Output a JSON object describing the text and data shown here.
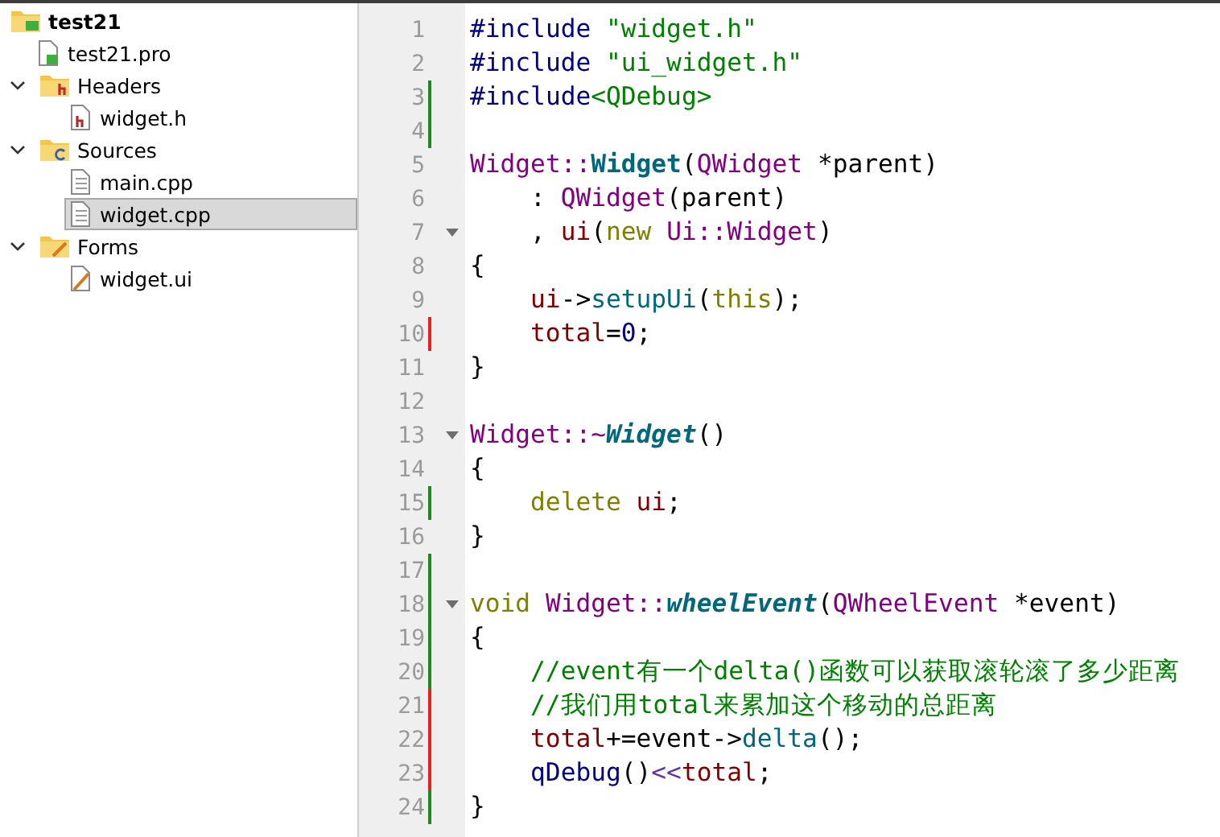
{
  "project_tree": {
    "label": "test21",
    "kind": "project",
    "selected": false,
    "children": [
      {
        "label": "test21.pro",
        "kind": "pro-file",
        "selected": false
      },
      {
        "label": "Headers",
        "kind": "header-folder",
        "selected": false,
        "expanded": true,
        "children": [
          {
            "label": "widget.h",
            "kind": "header-file",
            "selected": false
          }
        ]
      },
      {
        "label": "Sources",
        "kind": "source-folder",
        "selected": false,
        "expanded": true,
        "children": [
          {
            "label": "main.cpp",
            "kind": "source-file",
            "selected": false
          },
          {
            "label": "widget.cpp",
            "kind": "source-file",
            "selected": true
          }
        ]
      },
      {
        "label": "Forms",
        "kind": "form-folder",
        "selected": false,
        "expanded": true,
        "children": [
          {
            "label": "widget.ui",
            "kind": "form-file",
            "selected": false
          }
        ]
      }
    ]
  },
  "editor": {
    "lines": [
      {
        "number": "1",
        "added": false,
        "modified": false,
        "foldable": false,
        "indented": false,
        "tokens": [
          {
            "text": "#include ",
            "kind": "preprocessor"
          },
          {
            "text": "\"widget.h\"",
            "kind": "string"
          }
        ]
      },
      {
        "number": "2",
        "added": false,
        "modified": false,
        "foldable": false,
        "indented": false,
        "tokens": [
          {
            "text": "#include ",
            "kind": "preprocessor"
          },
          {
            "text": "\"ui_widget.h\"",
            "kind": "string"
          }
        ]
      },
      {
        "number": "3",
        "added": true,
        "modified": false,
        "foldable": false,
        "indented": false,
        "tokens": [
          {
            "text": "#include",
            "kind": "preprocessor"
          },
          {
            "text": "<QDebug>",
            "kind": "string"
          }
        ]
      },
      {
        "number": "4",
        "added": true,
        "modified": false,
        "foldable": false
      },
      {
        "number": "5",
        "added": false,
        "modified": false,
        "foldable": false,
        "indented": false,
        "tokens": [
          {
            "text": "Widget::",
            "kind": "type"
          },
          {
            "text": "Widget",
            "kind": "declaration"
          },
          {
            "text": "(",
            "kind": "plain"
          },
          {
            "text": "QWidget",
            "kind": "type"
          },
          {
            "text": " *parent)",
            "kind": "plain"
          }
        ]
      },
      {
        "number": "6",
        "added": false,
        "modified": false,
        "foldable": false,
        "indented": true,
        "tokens": [
          {
            "text": ": ",
            "kind": "plain"
          },
          {
            "text": "QWidget",
            "kind": "type"
          },
          {
            "text": "(parent)",
            "kind": "plain"
          }
        ]
      },
      {
        "number": "7",
        "added": false,
        "modified": false,
        "foldable": true,
        "indented": true,
        "tokens": [
          {
            "text": ", ",
            "kind": "plain"
          },
          {
            "text": "ui",
            "kind": "member"
          },
          {
            "text": "(",
            "kind": "plain"
          },
          {
            "text": "new ",
            "kind": "keyword"
          },
          {
            "text": "Ui::Widget",
            "kind": "type"
          },
          {
            "text": ")",
            "kind": "plain"
          }
        ]
      },
      {
        "number": "8",
        "added": false,
        "modified": false,
        "foldable": false,
        "indented": false,
        "tokens": [
          {
            "text": "{",
            "kind": "plain"
          }
        ]
      },
      {
        "number": "9",
        "added": false,
        "modified": false,
        "foldable": false,
        "indented": true,
        "tokens": [
          {
            "text": "ui",
            "kind": "member"
          },
          {
            "text": "->",
            "kind": "plain"
          },
          {
            "text": "setupUi",
            "kind": "function"
          },
          {
            "text": "(",
            "kind": "plain"
          },
          {
            "text": "this",
            "kind": "keyword"
          },
          {
            "text": ");",
            "kind": "plain"
          }
        ]
      },
      {
        "number": "10",
        "added": false,
        "modified": true,
        "foldable": false,
        "indented": true,
        "tokens": [
          {
            "text": "total",
            "kind": "member"
          },
          {
            "text": "=",
            "kind": "plain"
          },
          {
            "text": "0",
            "kind": "number"
          },
          {
            "text": ";",
            "kind": "plain"
          }
        ]
      },
      {
        "number": "11",
        "added": false,
        "modified": false,
        "foldable": false,
        "indented": false,
        "tokens": [
          {
            "text": "}",
            "kind": "plain"
          }
        ]
      },
      {
        "number": "12",
        "added": false,
        "modified": false,
        "foldable": false
      },
      {
        "number": "13",
        "added": false,
        "modified": false,
        "foldable": true,
        "indented": false,
        "tokens": [
          {
            "text": "Widget::~",
            "kind": "type"
          },
          {
            "text": "Widget",
            "kind": "virtual-declaration"
          },
          {
            "text": "()",
            "kind": "plain"
          }
        ]
      },
      {
        "number": "14",
        "added": false,
        "modified": false,
        "foldable": false,
        "indented": false,
        "tokens": [
          {
            "text": "{",
            "kind": "plain"
          }
        ]
      },
      {
        "number": "15",
        "added": true,
        "modified": false,
        "foldable": false,
        "indented": true,
        "tokens": [
          {
            "text": "delete ",
            "kind": "keyword"
          },
          {
            "text": "ui",
            "kind": "member"
          },
          {
            "text": ";",
            "kind": "plain"
          }
        ]
      },
      {
        "number": "16",
        "added": false,
        "modified": false,
        "foldable": false,
        "indented": false,
        "tokens": [
          {
            "text": "}",
            "kind": "plain"
          }
        ]
      },
      {
        "number": "17",
        "added": true,
        "modified": false,
        "foldable": false
      },
      {
        "number": "18",
        "added": true,
        "modified": false,
        "foldable": true,
        "indented": false,
        "tokens": [
          {
            "text": "void ",
            "kind": "keyword"
          },
          {
            "text": "Widget::",
            "kind": "type"
          },
          {
            "text": "wheelEvent",
            "kind": "virtual-declaration"
          },
          {
            "text": "(",
            "kind": "plain"
          },
          {
            "text": "QWheelEvent",
            "kind": "type"
          },
          {
            "text": " *event)",
            "kind": "plain"
          }
        ]
      },
      {
        "number": "19",
        "added": true,
        "modified": false,
        "foldable": false,
        "indented": false,
        "tokens": [
          {
            "text": "{",
            "kind": "plain"
          }
        ]
      },
      {
        "number": "20",
        "added": true,
        "modified": false,
        "foldable": false,
        "indented": true,
        "tokens": [
          {
            "text": "//event有一个delta()函数可以获取滚轮滚了多少距离",
            "kind": "comment"
          }
        ]
      },
      {
        "number": "21",
        "added": false,
        "modified": true,
        "foldable": false,
        "indented": true,
        "tokens": [
          {
            "text": "//我们用total来累加这个移动的总距离",
            "kind": "comment"
          }
        ]
      },
      {
        "number": "22",
        "added": false,
        "modified": true,
        "foldable": false,
        "indented": true,
        "tokens": [
          {
            "text": "total",
            "kind": "member"
          },
          {
            "text": "+=event->",
            "kind": "plain"
          },
          {
            "text": "delta",
            "kind": "function"
          },
          {
            "text": "();",
            "kind": "plain"
          }
        ]
      },
      {
        "number": "23",
        "added": false,
        "modified": true,
        "foldable": false,
        "indented": true,
        "tokens": [
          {
            "text": "qDebug",
            "kind": "global"
          },
          {
            "text": "()",
            "kind": "plain"
          },
          {
            "text": "<<",
            "kind": "operator"
          },
          {
            "text": "total",
            "kind": "member"
          },
          {
            "text": ";",
            "kind": "plain"
          }
        ]
      },
      {
        "number": "24",
        "added": true,
        "modified": false,
        "foldable": false,
        "indented": false,
        "tokens": [
          {
            "text": "}",
            "kind": "plain"
          }
        ]
      }
    ]
  }
}
